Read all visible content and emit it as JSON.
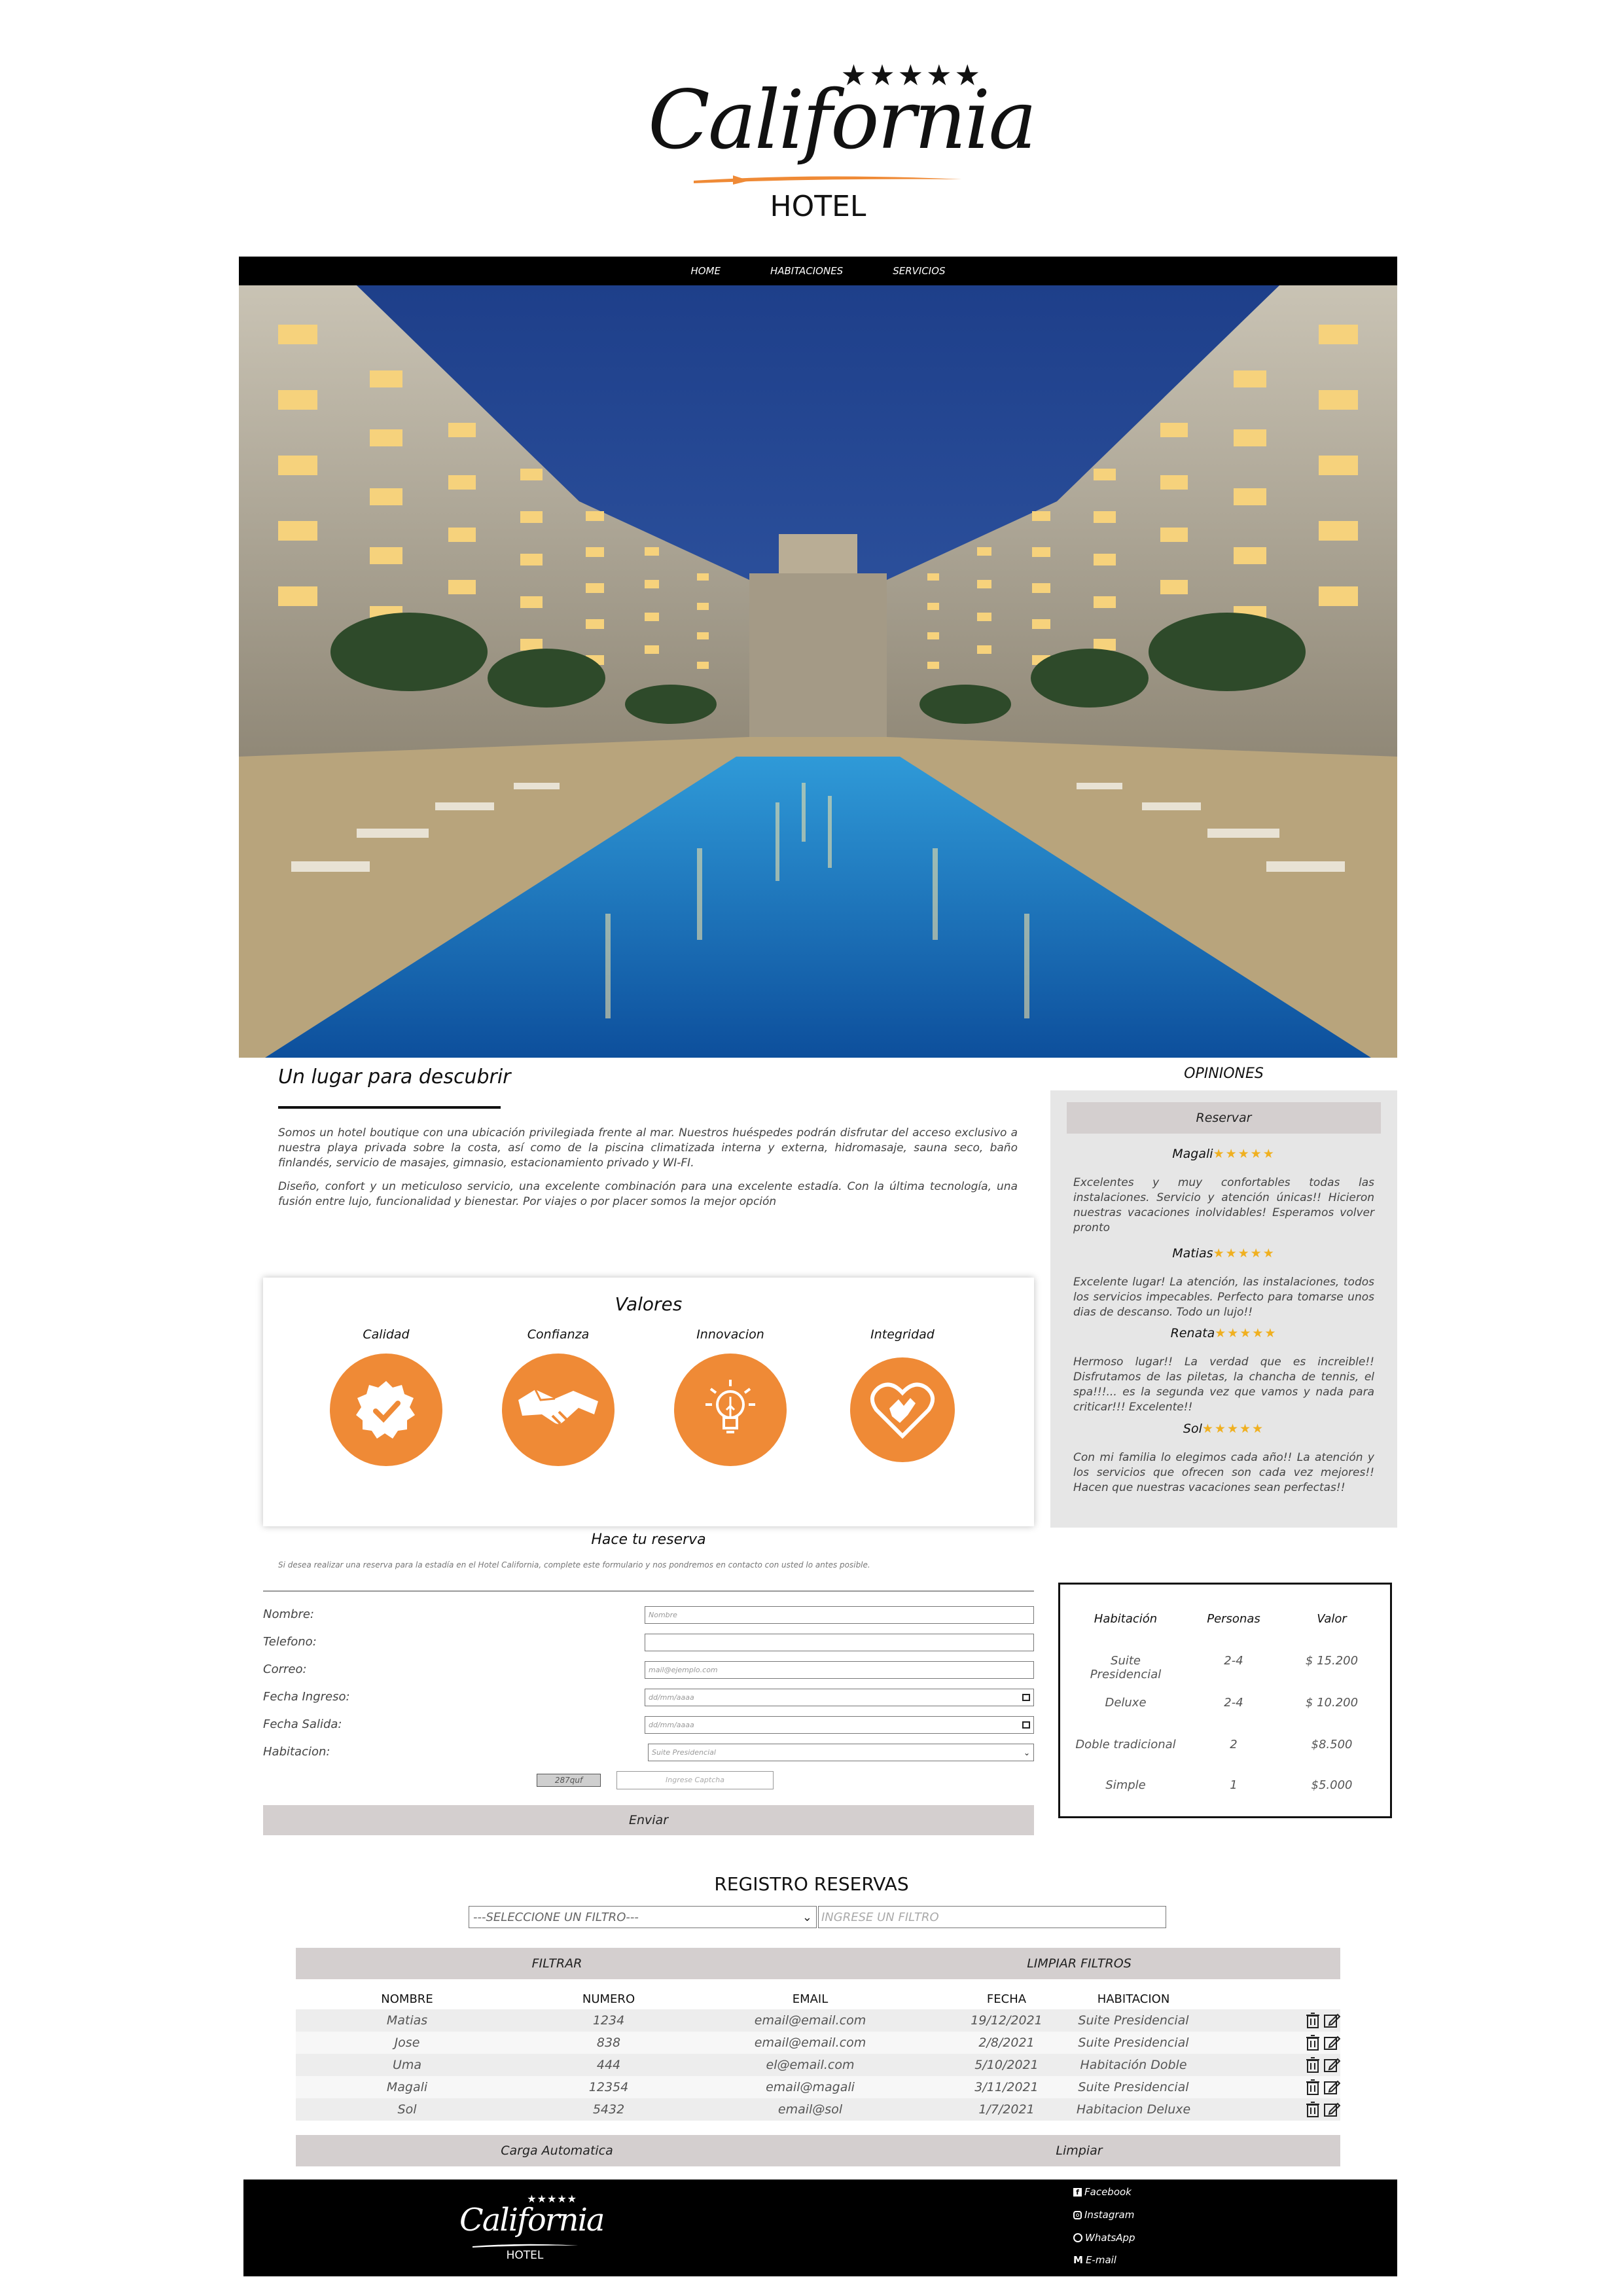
{
  "brand": {
    "name": "California",
    "sub": "HOTEL",
    "stars": "★★★★★",
    "accent_color": "#ef8a36"
  },
  "nav": {
    "items": [
      {
        "label": "HOME"
      },
      {
        "label": "HABITACIONES"
      },
      {
        "label": "SERVICIOS"
      }
    ]
  },
  "intro": {
    "title": "Un lugar para descubrir",
    "p1": "Somos un hotel boutique con una ubicación privilegiada frente al mar. Nuestros huéspedes podrán disfrutar del acceso exclusivo a nuestra playa privada sobre la costa, así como de la piscina climatizada interna y externa, hidromasaje, sauna seco, baño finlandés, servicio de masajes, gimnasio, estacionamiento privado y WI-FI.",
    "p2": "Diseño, confort y un meticuloso servicio, una excelente combinación para una excelente estadía. Con la última tecnología, una fusión entre lujo, funcionalidad y bienestar. Por viajes o por placer somos la mejor opción"
  },
  "opiniones": {
    "title": "OPINIONES",
    "button": "Reservar",
    "stars": "★★★★★",
    "reviews": [
      {
        "name": "Magali",
        "text": "Excelentes y muy confortables todas las instalaciones. Servicio y atención únicas!! Hicieron nuestras vacaciones inolvidables! Esperamos volver pronto"
      },
      {
        "name": "Matias",
        "text": "Excelente lugar! La atención, las instalaciones, todos los servicios impecables. Perfecto para tomarse unos dias de descanso. Todo un lujo!!"
      },
      {
        "name": "Renata",
        "text": "Hermoso lugar!! La verdad que es increible!! Disfrutamos de las piletas, la chancha de tennis, el spa!!!... es la segunda vez que vamos y nada para criticar!!! Excelente!!"
      },
      {
        "name": "Sol",
        "text": "Con mi familia lo elegimos cada año!! La atención y los servicios que ofrecen son cada vez mejores!! Hacen que nuestras vacaciones sean perfectas!!"
      }
    ]
  },
  "valores": {
    "title": "Valores",
    "items": [
      {
        "label": "Calidad",
        "icon": "quality-badge-icon"
      },
      {
        "label": "Confianza",
        "icon": "handshake-icon"
      },
      {
        "label": "Innovacion",
        "icon": "lightbulb-icon"
      },
      {
        "label": "Integridad",
        "icon": "heart-hand-icon"
      }
    ]
  },
  "reserva": {
    "title": "Hace tu reserva",
    "subtitle": "Si desea realizar una reserva para la estadía en el Hotel California, complete este formulario y nos pondremos en contacto con usted lo antes posible.",
    "fields": [
      {
        "label": "Nombre:",
        "placeholder": "Nombre"
      },
      {
        "label": "Telefono:",
        "placeholder": ""
      },
      {
        "label": "Correo:",
        "placeholder": "mail@ejemplo.com"
      },
      {
        "label": "Fecha Ingreso:",
        "placeholder": "dd/mm/aaaa"
      },
      {
        "label": "Fecha Salida:",
        "placeholder": "dd/mm/aaaa"
      },
      {
        "label": "Habitacion:",
        "placeholder": "Suite Presidencial"
      }
    ],
    "captcha": "287quf",
    "captcha_placeholder": "Ingrese Captcha",
    "submit": "Enviar"
  },
  "precios": {
    "headers": [
      "Habitación",
      "Personas",
      "Valor"
    ],
    "rows": [
      [
        "Suite Presidencial",
        "2-4",
        "$ 15.200"
      ],
      [
        "Deluxe",
        "2-4",
        "$ 10.200"
      ],
      [
        "Doble tradicional",
        "2",
        "$8.500"
      ],
      [
        "Simple",
        "1",
        "$5.000"
      ]
    ]
  },
  "registro": {
    "title": "REGISTRO RESERVAS",
    "select_value": "---SELECCIONE UN FILTRO---",
    "filter_placeholder": "INGRESE UN FILTRO",
    "filtrar": "FILTRAR",
    "limpiar_filtros": "LIMPIAR FILTROS",
    "headers": [
      "NOMBRE",
      "NUMERO",
      "EMAIL",
      "FECHA",
      "HABITACION"
    ],
    "rows": [
      [
        "Matias",
        "1234",
        "email@email.com",
        "19/12/2021",
        "Suite Presidencial"
      ],
      [
        "Jose",
        "838",
        "email@email.com",
        "2/8/2021",
        "Suite Presidencial"
      ],
      [
        "Uma",
        "444",
        "el@email.com",
        "5/10/2021",
        "Habitación Doble"
      ],
      [
        "Magali",
        "12354",
        "email@magali",
        "3/11/2021",
        "Suite Presidencial"
      ],
      [
        "Sol",
        "5432",
        "email@sol",
        "1/7/2021",
        "Habitacion Deluxe"
      ]
    ],
    "carga": "Carga Automatica",
    "limpiar": "Limpiar"
  },
  "footer": {
    "links": [
      {
        "label": "Facebook",
        "icon": "facebook-icon"
      },
      {
        "label": "Instagram",
        "icon": "instagram-icon"
      },
      {
        "label": "WhatsApp",
        "icon": "whatsapp-icon"
      },
      {
        "label": "E-mail",
        "icon": "email-icon"
      }
    ]
  }
}
